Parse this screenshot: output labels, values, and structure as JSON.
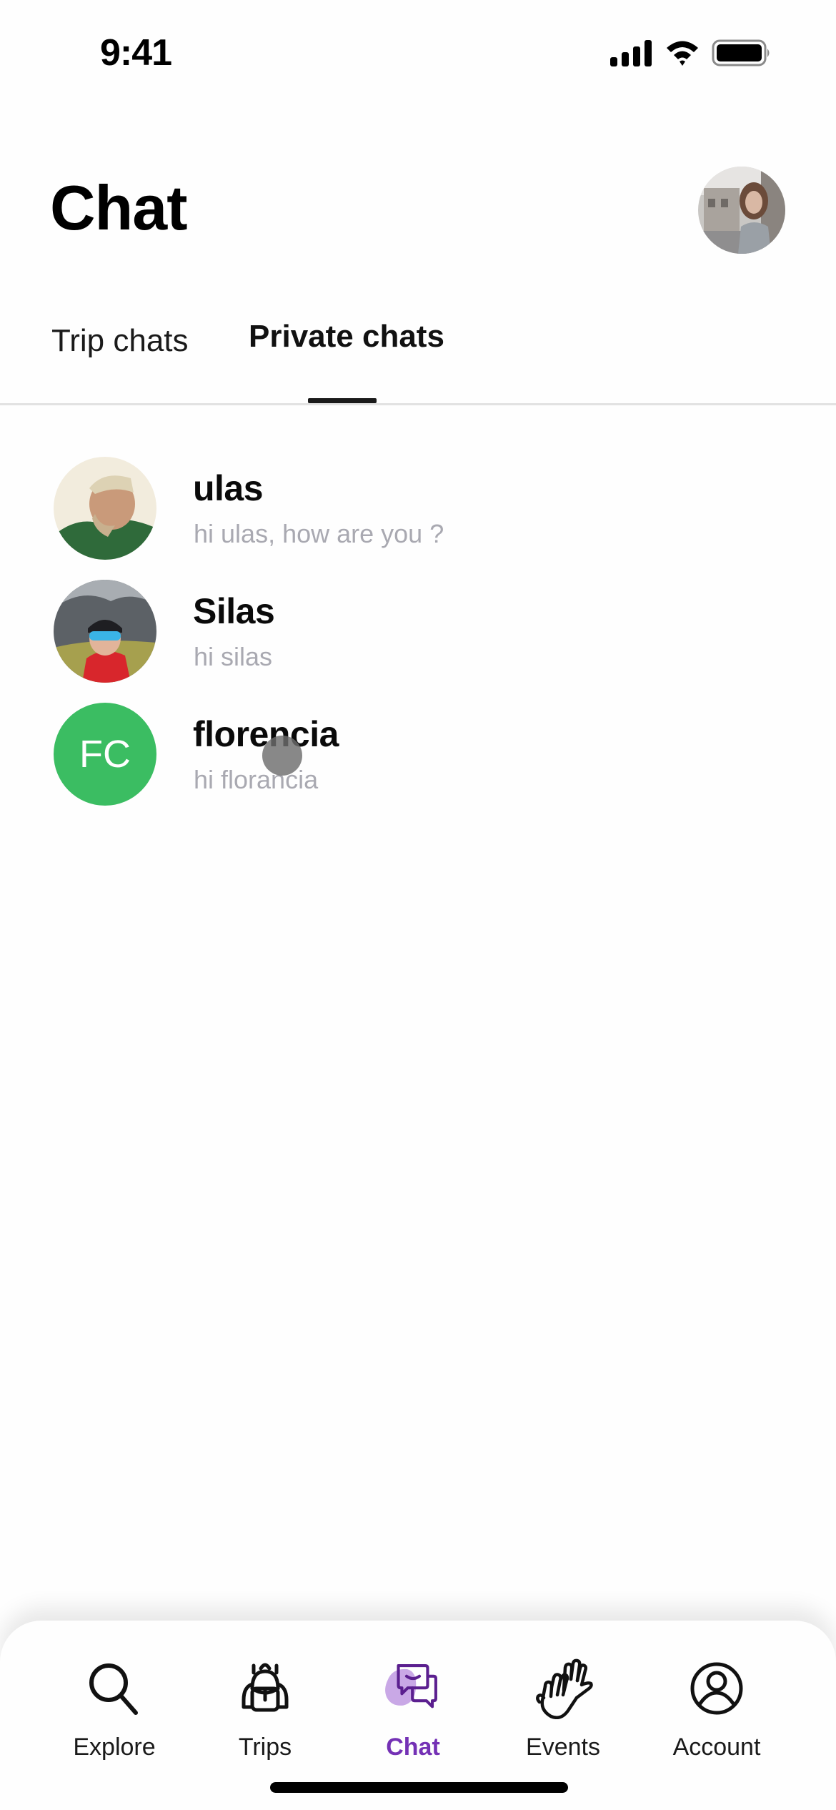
{
  "status_bar": {
    "time": "9:41",
    "icons": [
      "cellular-signal-icon",
      "wifi-icon",
      "battery-icon"
    ]
  },
  "header": {
    "title": "Chat",
    "profile_avatar": "profile-photo"
  },
  "tabs": [
    {
      "label": "Trip chats",
      "active": false
    },
    {
      "label": "Private chats",
      "active": true
    }
  ],
  "chats": [
    {
      "name": "ulas",
      "last_message": "hi ulas, how are you ?",
      "avatar": "photo"
    },
    {
      "name": "Silas",
      "last_message": "hi silas",
      "avatar": "photo"
    },
    {
      "name": "florencia",
      "last_message": "hi florancia",
      "avatar": "initials",
      "initials": "FC",
      "avatar_color": "#3bbd62"
    }
  ],
  "bottom_nav": {
    "items": [
      {
        "label": "Explore",
        "icon": "search-icon",
        "active": false
      },
      {
        "label": "Trips",
        "icon": "backpack-icon",
        "active": false
      },
      {
        "label": "Chat",
        "icon": "chat-bubbles-icon",
        "active": true
      },
      {
        "label": "Events",
        "icon": "high-five-icon",
        "active": false
      },
      {
        "label": "Account",
        "icon": "user-circle-icon",
        "active": false
      }
    ]
  },
  "colors": {
    "accent": "#7431b5",
    "accent_blob": "#c9a8e6",
    "muted_text": "#a9a9b1",
    "divider": "#e2e2e2",
    "initials_avatar": "#3bbd62"
  }
}
